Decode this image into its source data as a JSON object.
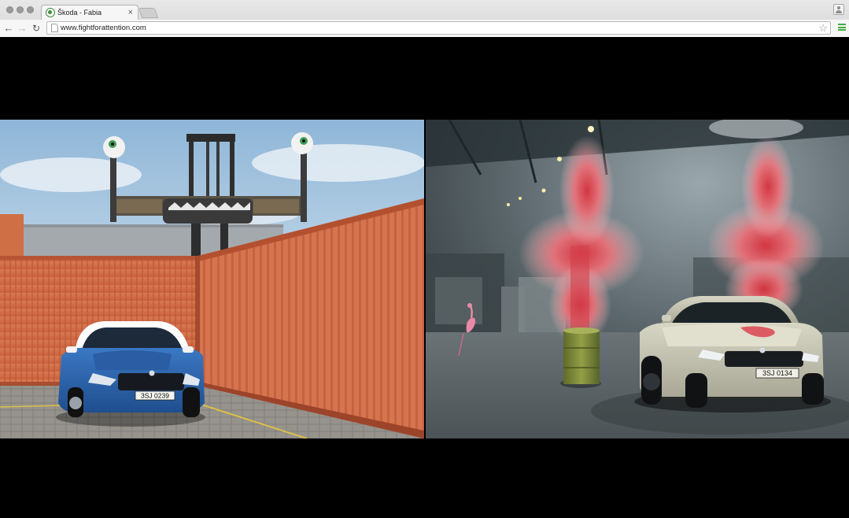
{
  "browser": {
    "tab_title": "Škoda - Fabia",
    "tab_close": "×",
    "url": "www.fightforattention.com"
  },
  "scene_left": {
    "plate": "3SJ 0239"
  },
  "scene_right": {
    "plate": "3SJ 0134"
  },
  "colors": {
    "skoda_green": "#4ba82e",
    "container_orange": "#d8704a",
    "car_left": "#2f66b0",
    "car_right": "#c9c7b4",
    "barrel": "#7f8c3a",
    "paint_splash": "#e05e68"
  }
}
